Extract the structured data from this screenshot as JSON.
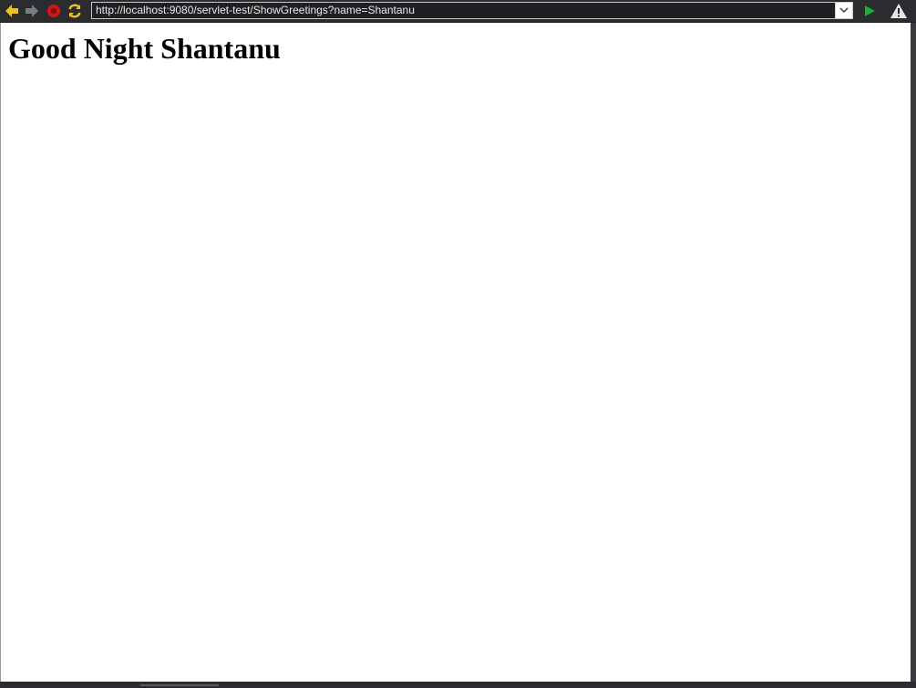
{
  "browser": {
    "url": "http://localhost:9080/servlet-test/ShowGreetings?name=Shantanu",
    "icons": {
      "back": "back-arrow-icon",
      "forward": "forward-arrow-icon",
      "stop": "stop-icon",
      "refresh": "refresh-icon",
      "dropdown": "chevron-down-icon",
      "go": "go-play-icon",
      "warning": "warning-icon"
    },
    "colors": {
      "back": "#f0c020",
      "forward": "#7a7d82",
      "stop": "#d01818",
      "refresh": "#f0c020",
      "go": "#18b030",
      "warning": "#ffffff"
    }
  },
  "page": {
    "heading": "Good Night Shantanu"
  }
}
